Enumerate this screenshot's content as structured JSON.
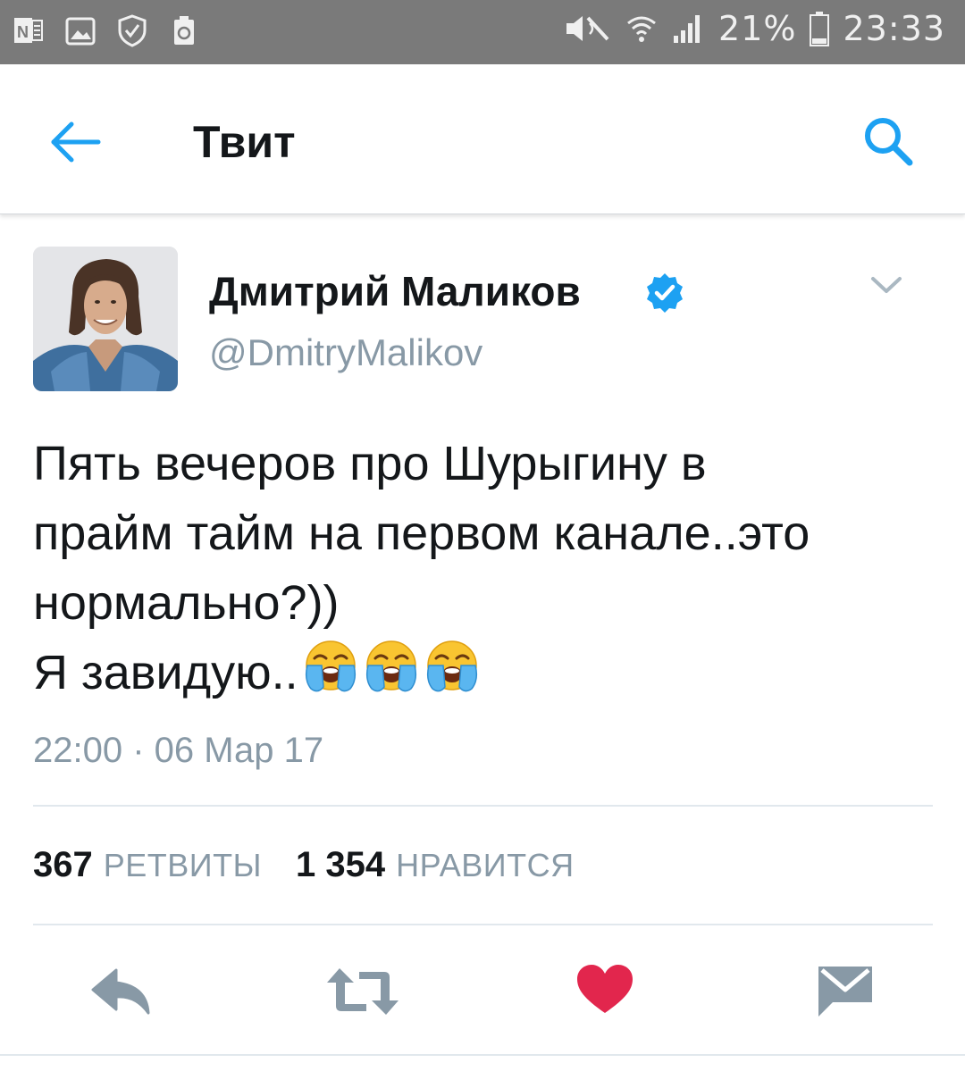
{
  "status_bar": {
    "battery_percent": "21%",
    "time": "23:33",
    "left_icons": [
      "onenote-icon",
      "gallery-icon",
      "shield-check-icon",
      "recycle-battery-icon"
    ],
    "right_icons": [
      "mute-icon",
      "wifi-icon",
      "signal-icon",
      "battery-icon"
    ]
  },
  "header": {
    "title": "Твит",
    "back_icon": "arrow-left-icon",
    "search_icon": "search-icon",
    "accent_color": "#1da1f2"
  },
  "tweet": {
    "display_name": "Дмитрий Маликов",
    "verified": true,
    "username": "@DmitryMalikov",
    "text_lines": [
      "Пять вечеров про Шурыгину в",
      "прайм тайм на первом канале..это",
      "нормально?))",
      "Я завидую.."
    ],
    "emojis": [
      "loudly-crying-face-emoji",
      "loudly-crying-face-emoji",
      "loudly-crying-face-emoji"
    ],
    "timestamp": "22:00 · 06 Мар 17",
    "retweets_count": "367",
    "retweets_label": "РЕТВИТЫ",
    "likes_count": "1 354",
    "likes_label": "НРАВИТСЯ"
  },
  "actions": {
    "icons": [
      "reply-icon",
      "retweet-icon",
      "heart-icon",
      "direct-message-icon"
    ],
    "like_color": "#e2264d",
    "icon_color": "#8899a6"
  }
}
